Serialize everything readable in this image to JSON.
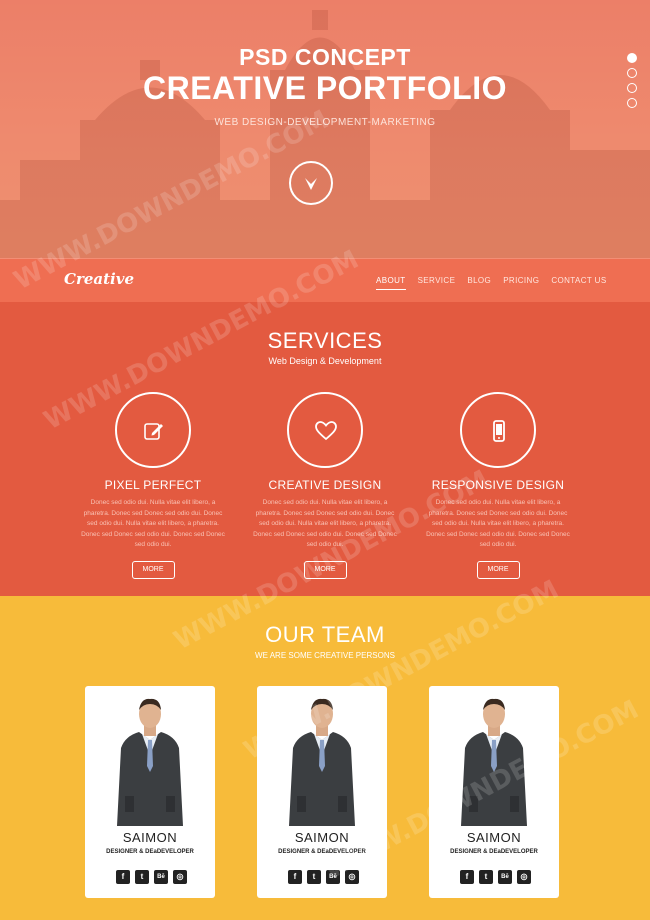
{
  "hero": {
    "pretitle": "PSD CONCEPT",
    "title": "CREATIVE PORTFOLIO",
    "subtitle": "WEB DESIGN-DEVELOPMENT-MARKETING",
    "slider_dots": 4,
    "active_dot": 0
  },
  "nav": {
    "logo": "Creative",
    "links": [
      "ABOUT",
      "SERVICE",
      "BLOG",
      "PRICING",
      "CONTACT US"
    ],
    "active": "ABOUT"
  },
  "services": {
    "title": "SERVICES",
    "subtitle": "Web Design & Development",
    "items": [
      {
        "icon": "pencil-edit-icon",
        "title": "PIXEL PERFECT",
        "text": "Donec sed odio dui. Nulla vitae elit libero, a pharetra. Donec sed Donec sed odio dui. Donec sed odio dui. Nulla vitae elit libero, a pharetra. Donec sed Donec sed odio dui. Donec sed Donec sed odio dui.",
        "button": "MORE"
      },
      {
        "icon": "heart-icon",
        "title": "CREATIVE DESIGN",
        "text": "Donec sed odio dui. Nulla vitae elit libero, a pharetra. Donec sed Donec sed odio dui. Donec sed odio dui. Nulla vitae elit libero, a pharetra. Donec sed Donec sed odio dui. Donec sed Donec sed odio dui.",
        "button": "MORE"
      },
      {
        "icon": "mobile-phone-icon",
        "title": "RESPONSIVE DESIGN",
        "text": "Donec sed odio dui. Nulla vitae elit libero, a pharetra. Donec sed Donec sed odio dui. Donec sed odio dui. Nulla vitae elit libero, a pharetra. Donec sed Donec sed odio dui. Donec sed Donec sed odio dui.",
        "button": "MORE"
      }
    ]
  },
  "team": {
    "title": "OUR TEAM",
    "subtitle": "WE ARE SOME CREATIVE PERSONS",
    "members": [
      {
        "name": "SAIMON",
        "role": "DESIGNER & DEaDEVELOPER"
      },
      {
        "name": "SAIMON",
        "role": "DESIGNER & DEaDEVELOPER"
      },
      {
        "name": "SAIMON",
        "role": "DESIGNER & DEaDEVELOPER"
      }
    ],
    "social_icons": [
      {
        "name": "facebook-icon",
        "glyph": "f"
      },
      {
        "name": "twitter-icon",
        "glyph": "t"
      },
      {
        "name": "behance-icon",
        "glyph": "Bē"
      },
      {
        "name": "dribbble-icon",
        "glyph": "◎"
      }
    ]
  },
  "watermark": "WWW.DOWNDEMO.COM",
  "colors": {
    "hero": "#ec7f68",
    "nav": "#ef6e52",
    "services": "#e35a40",
    "team": "#f7bb3a"
  }
}
